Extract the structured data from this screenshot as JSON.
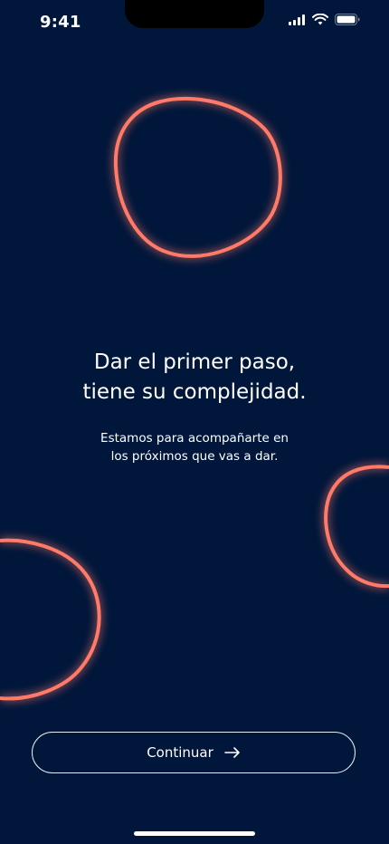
{
  "status_bar": {
    "time": "9:41",
    "icons": [
      "signal-icon",
      "wifi-icon",
      "battery-icon"
    ]
  },
  "content": {
    "headline_line1": "Dar el primer paso,",
    "headline_line2": "tiene su complejidad.",
    "subtitle_line1": "Estamos para acompañarte en",
    "subtitle_line2": "los próximos que vas a dar."
  },
  "button": {
    "label": "Continuar",
    "icon": "arrow-right-icon"
  },
  "colors": {
    "background": "#00163a",
    "accent": "#ff7a67",
    "text": "#ffffff"
  }
}
